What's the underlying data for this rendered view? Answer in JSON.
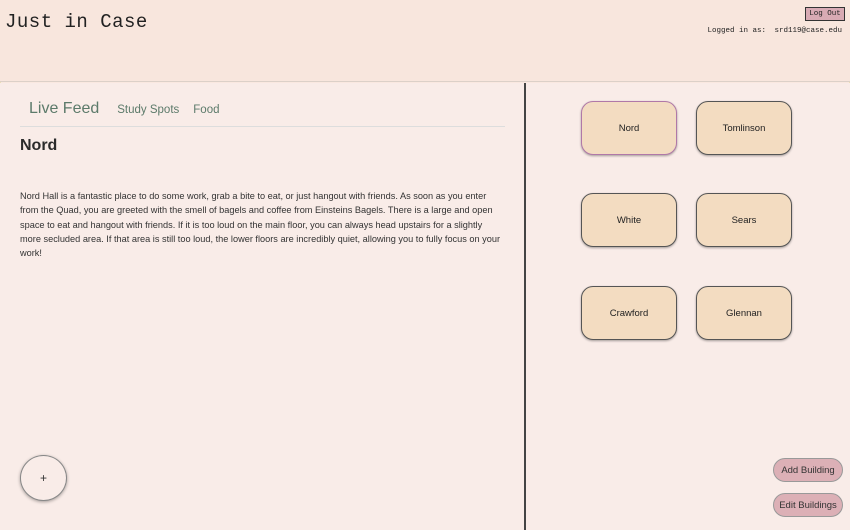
{
  "header": {
    "app_title": "Just in Case",
    "logout_label": "Log Out",
    "logged_in_label": "Logged in as:",
    "user_email": "srd119@case.edu"
  },
  "tabs": [
    {
      "label": "Live Feed",
      "active": true
    },
    {
      "label": "Study Spots",
      "active": false
    },
    {
      "label": "Food",
      "active": false
    }
  ],
  "detail": {
    "title": "Nord",
    "description": "Nord Hall is a fantastic place to do some work, grab a bite to eat, or just hangout with friends. As soon as you enter from the Quad, you are greeted with the smell of bagels and coffee from Einsteins Bagels. There is a large and open space to eat and hangout with friends. If it is too loud on the main floor, you can always head upstairs for a slightly more secluded area. If that area is still too loud, the lower floors are incredibly quiet, allowing you to fully focus on your work!"
  },
  "fab": {
    "label": "+"
  },
  "buildings": [
    {
      "name": "Nord",
      "selected": true
    },
    {
      "name": "Tomlinson",
      "selected": false
    },
    {
      "name": "White",
      "selected": false
    },
    {
      "name": "Sears",
      "selected": false
    },
    {
      "name": "Crawford",
      "selected": false
    },
    {
      "name": "Glennan",
      "selected": false
    }
  ],
  "actions": {
    "add_building": "Add Building",
    "edit_buildings": "Edit Buildings"
  },
  "colors": {
    "background": "#fae8e0",
    "tab_text": "#5c7a6a",
    "building_fill": "#f3dcc1",
    "selected_border": "#b078a8",
    "pill_fill": "#dcb0b6"
  }
}
